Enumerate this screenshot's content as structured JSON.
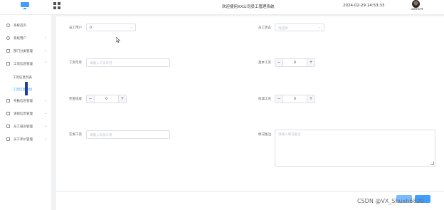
{
  "header": {
    "title": "欢迎使用XX公司员工管理系统",
    "datetime": "2024-02-29 14:53:33",
    "user": "admin"
  },
  "sidebar": {
    "items": [
      {
        "label": "系统首页",
        "icon": "home-icon"
      },
      {
        "label": "系统用户",
        "icon": "user-icon"
      },
      {
        "label": "部门分类管理",
        "icon": "folder-icon"
      },
      {
        "label": "工资信息管理",
        "icon": "money-icon"
      },
      {
        "label": "考勤信息管理",
        "icon": "calendar-icon"
      },
      {
        "label": "请假信息管理",
        "icon": "document-icon"
      },
      {
        "label": "员工培训管理",
        "icon": "book-icon"
      },
      {
        "label": "员工评价管理",
        "icon": "star-icon"
      }
    ],
    "subitems": [
      {
        "label": "工资信息列表"
      },
      {
        "label": "工资信息添加"
      }
    ]
  },
  "form": {
    "employee": {
      "label": "员工用户",
      "value": "0"
    },
    "status": {
      "label": "员工状态",
      "placeholder": "请选择"
    },
    "salary_month": {
      "label": "工资年月",
      "placeholder": "请输入工资年月"
    },
    "base_salary": {
      "label": "基本工资",
      "value": "0"
    },
    "bonus": {
      "label": "奖金提成",
      "value": "0"
    },
    "deduction": {
      "label": "扣减工资",
      "value": "0"
    },
    "actual_salary": {
      "label": "实发工资",
      "placeholder": "请输入实发工资"
    },
    "remark": {
      "label": "情况备注",
      "placeholder": "请输入情况备注"
    }
  },
  "watermark": "CSDN @VX_Shuxh6820"
}
